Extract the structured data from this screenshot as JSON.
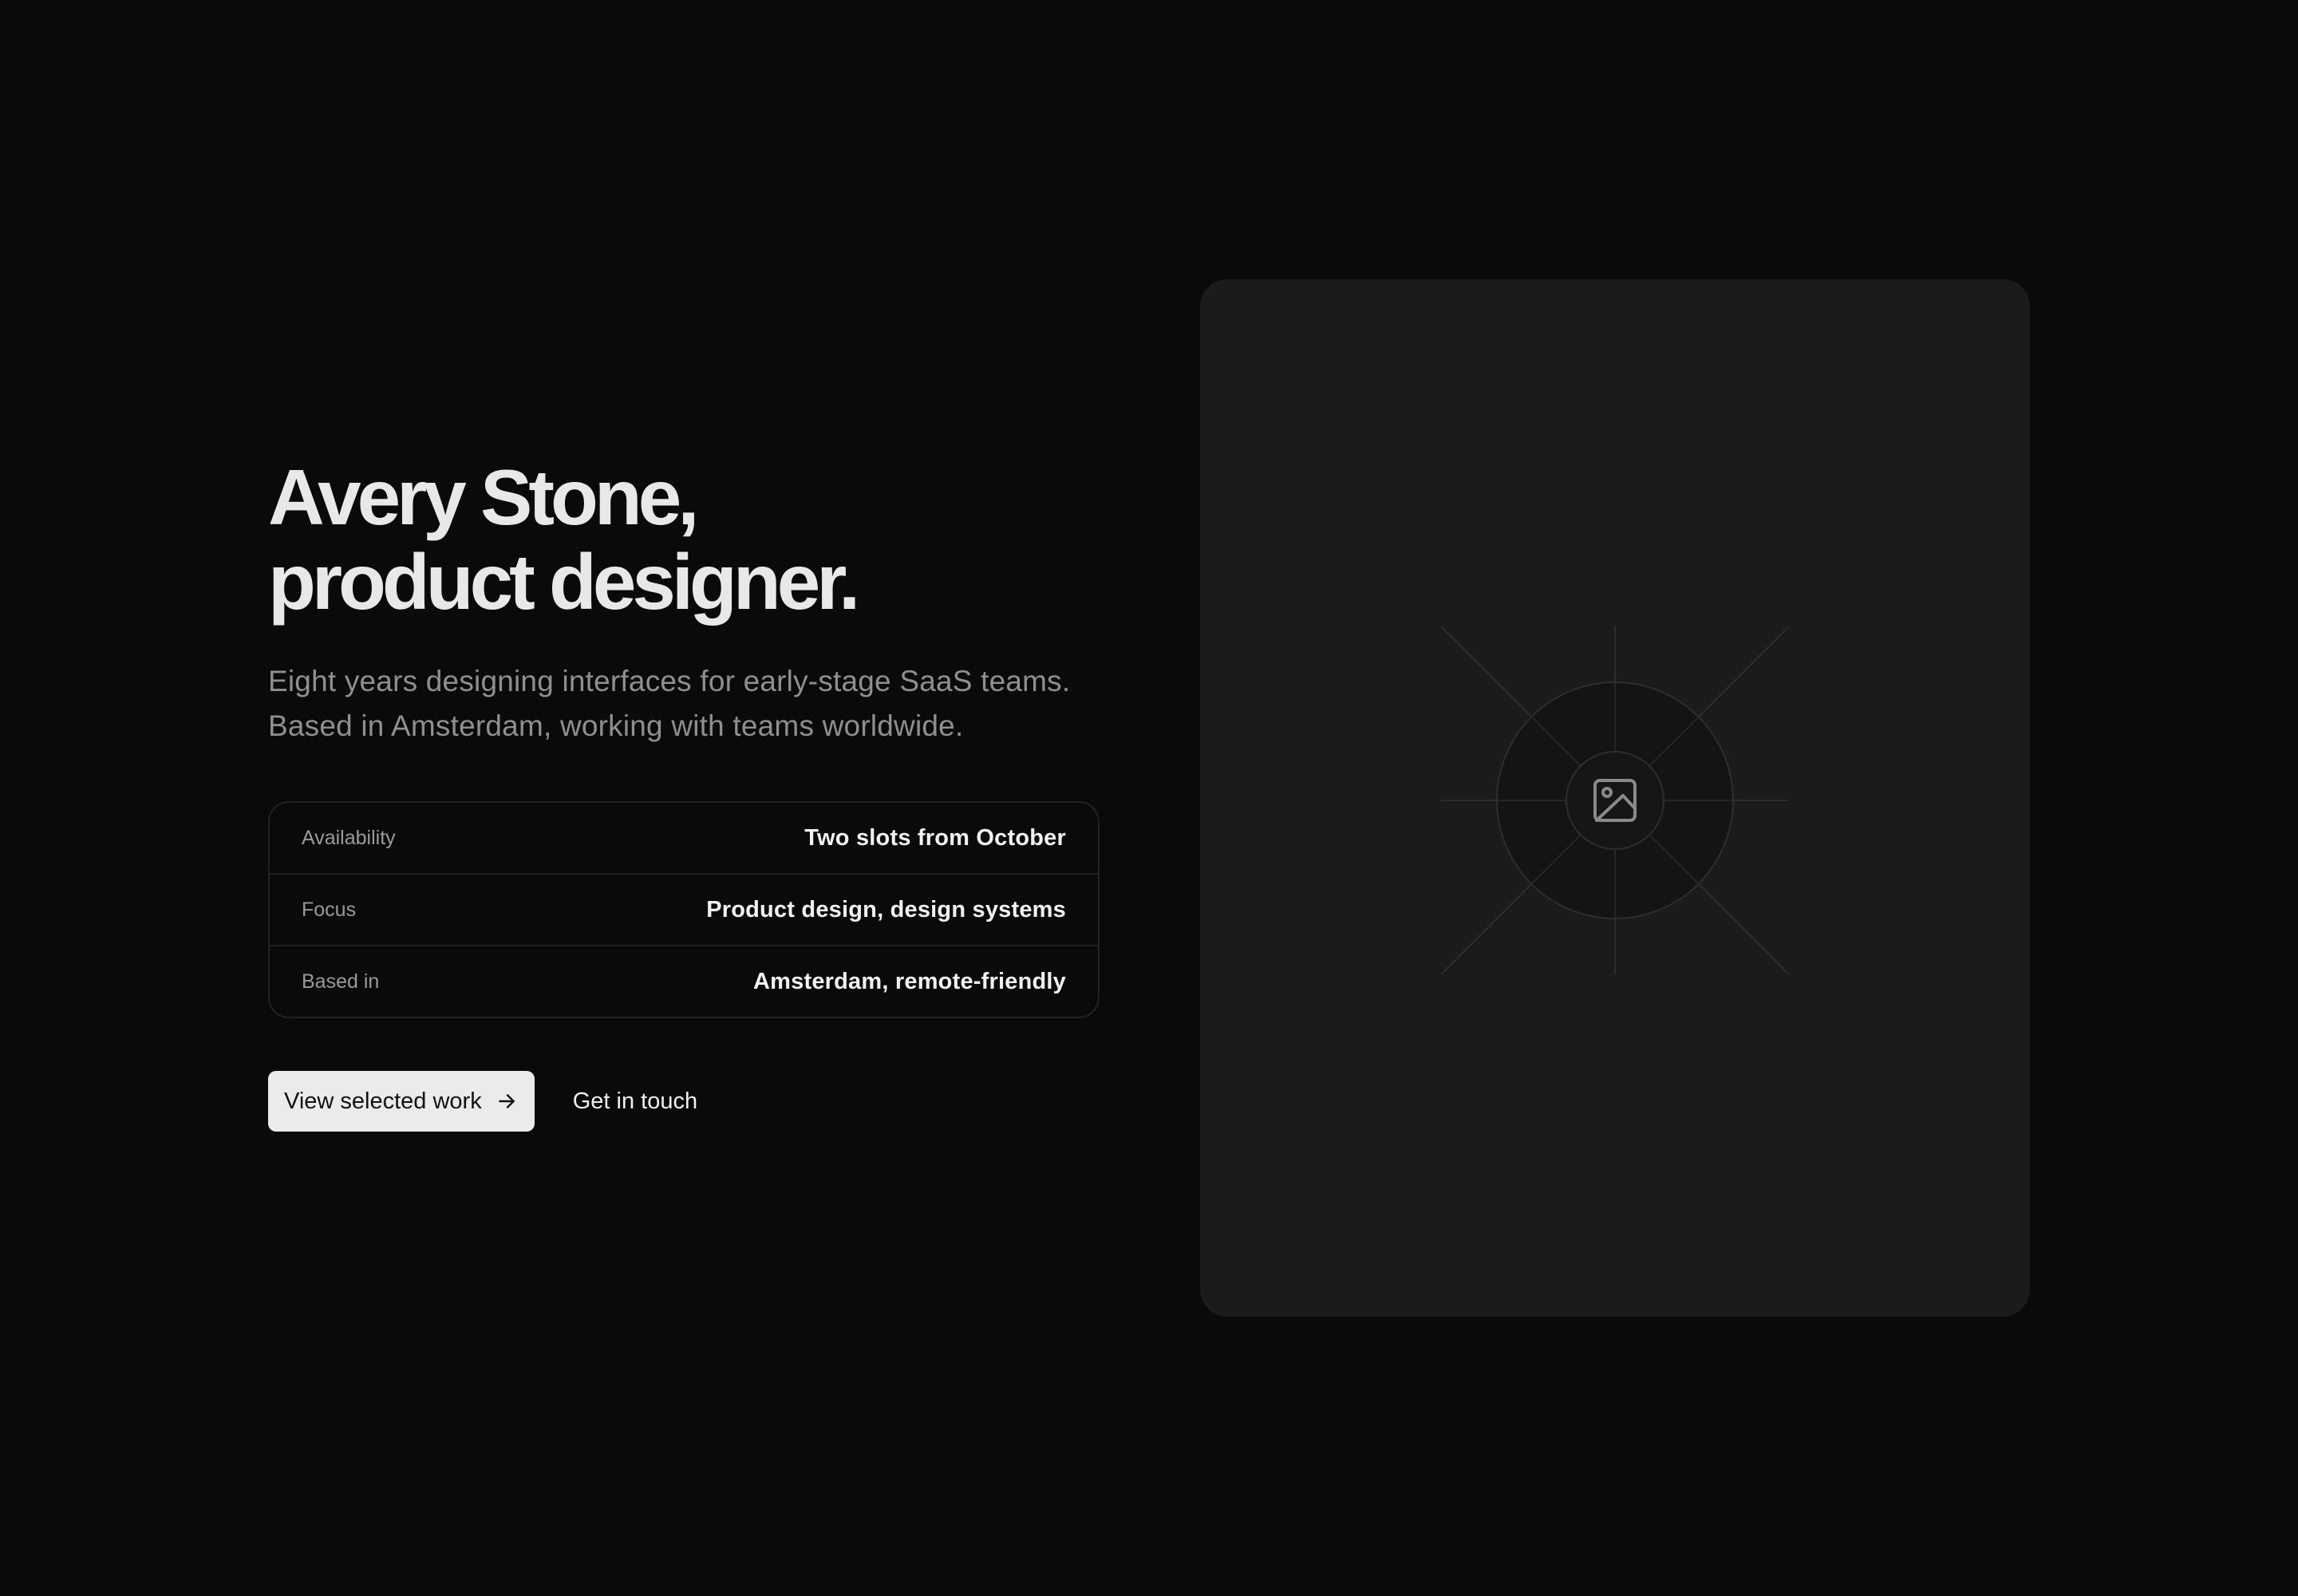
{
  "hero": {
    "headline_line1": "Avery Stone,",
    "headline_line2": "product designer.",
    "subtitle_line1": "Eight years designing interfaces for early-stage SaaS teams.",
    "subtitle_line2": "Based in Amsterdam, working with teams worldwide."
  },
  "info": [
    {
      "label": "Availability",
      "value": "Two slots from October"
    },
    {
      "label": "Focus",
      "value": "Product design, design systems"
    },
    {
      "label": "Based in",
      "value": "Amsterdam, remote-friendly"
    }
  ],
  "actions": {
    "primary_label": "View selected work",
    "primary_icon": "arrow-right-icon",
    "secondary_label": "Get in touch"
  },
  "media": {
    "icon": "image-placeholder-icon"
  },
  "colors": {
    "background": "#0a0a0a",
    "card": "#1b1b1b",
    "primary_button": "#ebebeb"
  }
}
